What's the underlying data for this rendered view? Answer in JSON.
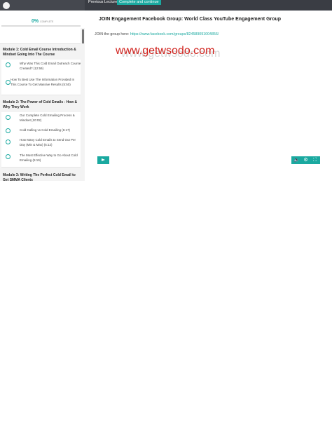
{
  "topbar": {
    "prev_label": "Previous Lecture",
    "complete_label": "Complete and continue"
  },
  "sidebar": {
    "progress_pct": "0%",
    "progress_word": "COMPLETE",
    "modules": [
      {
        "title": "Module 1: Cold Email Course Introduction & Mindset Going Into The Course",
        "lectures": [
          {
            "label": "Why Was This Cold Email Outreach Course Created? (12:59)"
          },
          {
            "label": "How To Best Use The Information Provided In This Course To Get Massive Results (5:50)"
          }
        ]
      },
      {
        "title": "Module 2: The Power of Cold Emails - How & Why They Work",
        "lectures": [
          {
            "label": "Our Complete Cold Emailing Process & Mindset (10:02)"
          },
          {
            "label": "Cold Calling vs Cold Emailing (6:17)"
          },
          {
            "label": "How Many Cold Emails to Send Out Per Day (Min & Max) (5:12)"
          },
          {
            "label": "The Most Effective Way to Go About Cold Emailing (5:19)"
          }
        ]
      },
      {
        "title": "Module 3: Writing The Perfect Cold Email to Get SMMA Clients",
        "lectures": []
      }
    ]
  },
  "main": {
    "lecture_title": "JOIN Engagement Facebook Group: World Class YouTube Engagement Group",
    "join_text": "JOIN the group here: ",
    "join_link": "https://www.facebook.com/groups/824589091004856/",
    "watermark": "www.getwsodo.com"
  },
  "player": {
    "play_icon": "play-icon",
    "volume_icon": "volume-icon",
    "settings_icon": "gear-icon",
    "fullscreen_icon": "fullscreen-icon"
  },
  "colors": {
    "accent": "#1aa9a0",
    "topbar": "#3a3d44",
    "sidebar": "#f3f3f3",
    "watermark": "#d0211c"
  }
}
